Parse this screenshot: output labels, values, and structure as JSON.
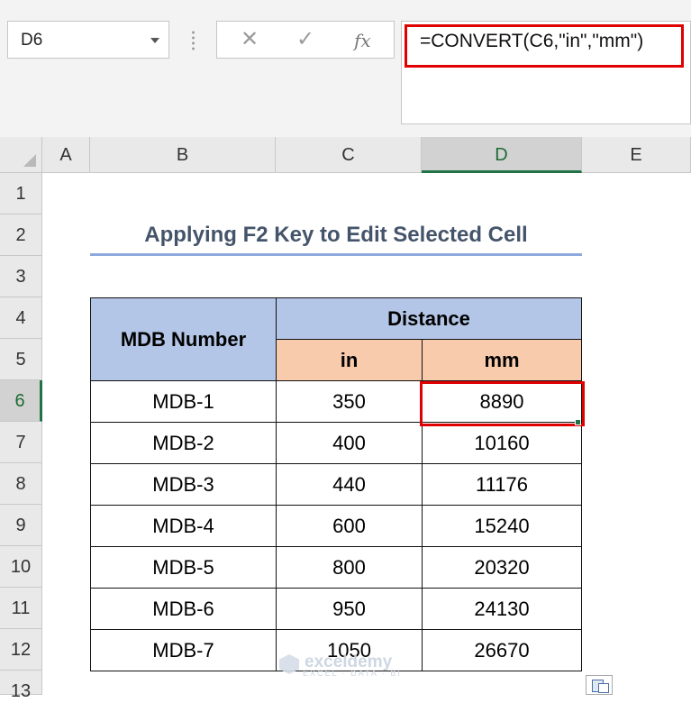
{
  "formula_bar": {
    "name_box": "D6",
    "cancel_icon": "✕",
    "enter_icon": "✓",
    "fx_icon": "fx",
    "formula": "=CONVERT(C6,\"in\",\"mm\")"
  },
  "columns": [
    "A",
    "B",
    "C",
    "D",
    "E"
  ],
  "selected_column": "D",
  "rows": [
    "1",
    "2",
    "3",
    "4",
    "5",
    "6",
    "7",
    "8",
    "9",
    "10",
    "11",
    "12",
    "13"
  ],
  "selected_row": "6",
  "sheet": {
    "title": "Applying F2 Key to Edit Selected Cell",
    "header_mdb": "MDB Number",
    "header_distance": "Distance",
    "header_in": "in",
    "header_mm": "mm",
    "table": [
      [
        "MDB-1",
        "350",
        "8890"
      ],
      [
        "MDB-2",
        "400",
        "10160"
      ],
      [
        "MDB-3",
        "440",
        "11176"
      ],
      [
        "MDB-4",
        "600",
        "15240"
      ],
      [
        "MDB-5",
        "800",
        "20320"
      ],
      [
        "MDB-6",
        "950",
        "24130"
      ],
      [
        "MDB-7",
        "1050",
        "26670"
      ]
    ],
    "active_cell": "D6"
  },
  "watermark": {
    "name": "exceldemy",
    "tagline": "EXCEL · DATA · BI"
  },
  "colors": {
    "header_blue": "#b4c6e7",
    "header_peach": "#f8cbad",
    "highlight": "#e00000",
    "title": "#44546a",
    "title_underline": "#8ea9db",
    "select_green": "#217346"
  }
}
